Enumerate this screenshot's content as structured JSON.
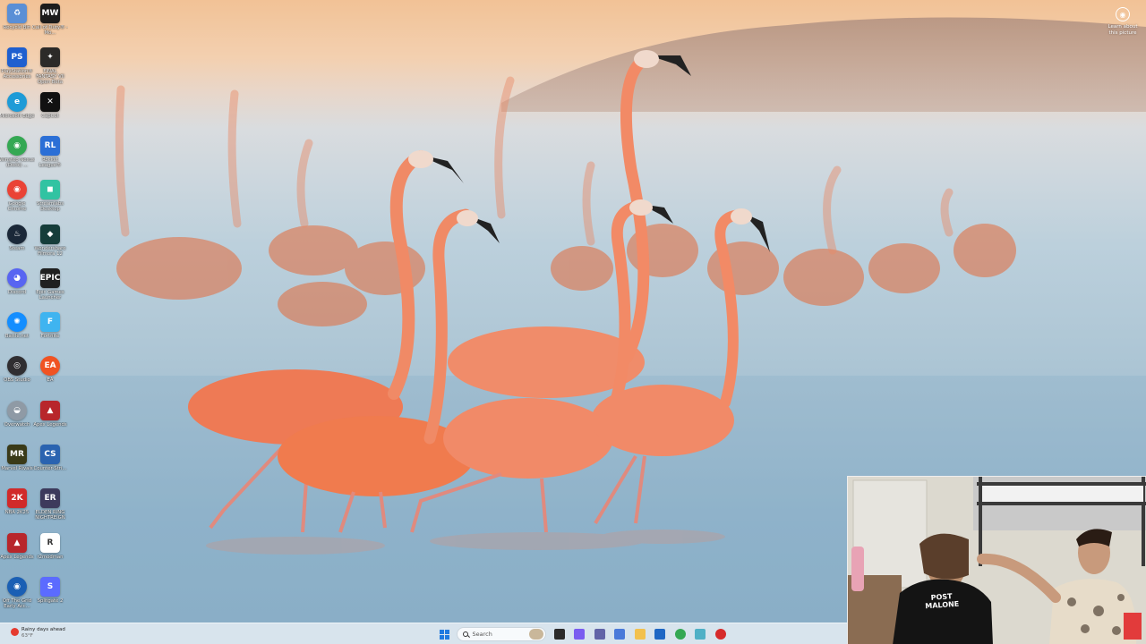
{
  "desktop_icons": [
    {
      "label": "Recycle Bin",
      "icon": "recycle-bin-icon",
      "color": "#5a8fd6",
      "glyph": "♻",
      "round": false
    },
    {
      "label": "Call of Duty® - Mo...",
      "icon": "call-of-duty-icon",
      "color": "#1c1c1c",
      "glyph": "MW",
      "round": false
    },
    {
      "label": "PlayStation® Accessories",
      "icon": "playstation-accessories-icon",
      "color": "#1f5fcf",
      "glyph": "PS",
      "round": false
    },
    {
      "label": "FINAL FANTASY VII Open Beta",
      "icon": "final-fantasy-icon",
      "color": "#2c2a28",
      "glyph": "✦",
      "round": false
    },
    {
      "label": "Microsoft Edge",
      "icon": "edge-icon",
      "color": "#1e9bd7",
      "glyph": "e",
      "round": true
    },
    {
      "label": "CapCut",
      "icon": "capcut-icon",
      "color": "#111111",
      "glyph": "✕",
      "round": false
    },
    {
      "label": "Winstep Nexus (Dock) ...",
      "icon": "chrome-app-icon",
      "color": "#34a853",
      "glyph": "◉",
      "round": true
    },
    {
      "label": "Rocket League®",
      "icon": "rocket-league-icon",
      "color": "#2b6fd6",
      "glyph": "RL",
      "round": false
    },
    {
      "label": "Google Chrome",
      "icon": "chrome-icon",
      "color": "#ea4335",
      "glyph": "◉",
      "round": true
    },
    {
      "label": "Streamlabs Desktop",
      "icon": "streamlabs-icon",
      "color": "#31c3a2",
      "glyph": "◼",
      "round": false
    },
    {
      "label": "Steam",
      "icon": "steam-icon",
      "color": "#1b2838",
      "glyph": "♨",
      "round": true
    },
    {
      "label": "Wondershare Filmora 12",
      "icon": "filmora-icon",
      "color": "#163d3a",
      "glyph": "◆",
      "round": false
    },
    {
      "label": "Discord",
      "icon": "discord-icon",
      "color": "#5865f2",
      "glyph": "◕",
      "round": true
    },
    {
      "label": "Epic Games Launcher",
      "icon": "epic-games-icon",
      "color": "#202020",
      "glyph": "EPIC",
      "round": false
    },
    {
      "label": "Battle.net",
      "icon": "battlenet-icon",
      "color": "#148eff",
      "glyph": "✺",
      "round": true
    },
    {
      "label": "Fortnite",
      "icon": "fortnite-icon",
      "color": "#3fb4f0",
      "glyph": "F",
      "round": false
    },
    {
      "label": "OBS Studio",
      "icon": "obs-icon",
      "color": "#302e31",
      "glyph": "◎",
      "round": true
    },
    {
      "label": "EA",
      "icon": "ea-icon",
      "color": "#f05323",
      "glyph": "EA",
      "round": true
    },
    {
      "label": "Overwatch",
      "icon": "overwatch-icon",
      "color": "#8f9aa5",
      "glyph": "◒",
      "round": true
    },
    {
      "label": "Apex Legends",
      "icon": "apex-legends-icon",
      "color": "#b8262b",
      "glyph": "▲",
      "round": false
    },
    {
      "label": "Marvel Rivals",
      "icon": "marvel-rivals-icon",
      "color": "#3a3a18",
      "glyph": "MR",
      "round": false
    },
    {
      "label": "Counter-Stri...",
      "icon": "counter-strike-icon",
      "color": "#2a63b0",
      "glyph": "CS",
      "round": false
    },
    {
      "label": "NBA 2K25",
      "icon": "nba2k25-icon",
      "color": "#d12a2a",
      "glyph": "2K",
      "round": false
    },
    {
      "label": "ELDEN RING NIGHTREIGN",
      "icon": "elden-ring-icon",
      "color": "#3d3a5c",
      "glyph": "ER",
      "round": false
    },
    {
      "label": "Apex Legends",
      "icon": "apex-legends-icon-2",
      "color": "#b8262b",
      "glyph": "▲",
      "round": false
    },
    {
      "label": "r2modman",
      "icon": "r2modman-icon",
      "color": "#ffffff",
      "glyph": "R",
      "round": false
    },
    {
      "label": "Off The Grid Early Acc...",
      "icon": "off-the-grid-icon",
      "color": "#1a5fb4",
      "glyph": "◉",
      "round": true
    },
    {
      "label": "Splitgate 2",
      "icon": "splitgate-icon",
      "color": "#5b6bff",
      "glyph": "S",
      "round": false
    }
  ],
  "learn_picture": {
    "label": "Learn about this picture",
    "icon": "camera-icon"
  },
  "webcam": {
    "shirt_text_1": "POST",
    "shirt_text_2": "MALONE"
  },
  "taskbar": {
    "weather_title": "Rainy days ahead",
    "weather_temp": "63°F",
    "search_placeholder": "Search",
    "apps": [
      {
        "name": "taskbar-task-view-icon",
        "color": "#2b2b2b"
      },
      {
        "name": "taskbar-copilot-icon",
        "color": "#7a5cf0"
      },
      {
        "name": "taskbar-teams-icon",
        "color": "#6264a7"
      },
      {
        "name": "taskbar-widgets-icon",
        "color": "#4a7ad9"
      },
      {
        "name": "taskbar-file-explorer-icon",
        "color": "#f2c14e"
      },
      {
        "name": "taskbar-store-icon",
        "color": "#1e67c4"
      },
      {
        "name": "taskbar-chrome-icon",
        "color": "#34a853"
      },
      {
        "name": "taskbar-notepad-icon",
        "color": "#4fb0c6"
      },
      {
        "name": "taskbar-recorder-icon",
        "color": "#d62b2b"
      }
    ]
  }
}
